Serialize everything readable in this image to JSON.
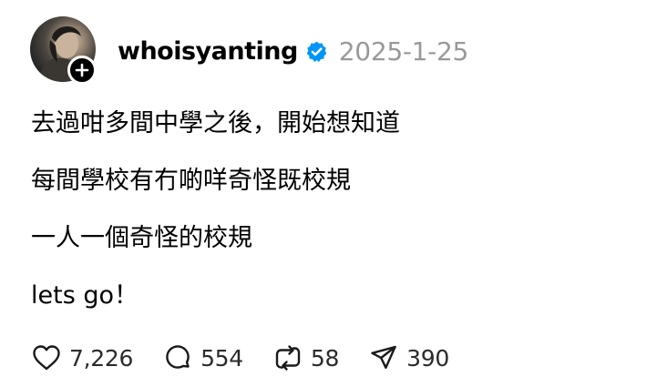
{
  "post": {
    "username": "whoisyanting",
    "timestamp": "2025-1-25",
    "verified": true,
    "lines": [
      "去過咁多間中學之後，開始想知道",
      "每間學校有冇啲咩奇怪既校規",
      "一人一個奇怪的校規",
      "lets go！"
    ]
  },
  "actions": {
    "likes": "7,226",
    "replies": "554",
    "reposts": "58",
    "shares": "390"
  },
  "icons": {
    "verified": "verified-badge-icon",
    "follow": "plus-icon",
    "like": "heart-icon",
    "reply": "comment-bubble-icon",
    "repost": "repost-arrows-icon",
    "share": "send-icon"
  },
  "colors": {
    "verified_blue": "#0095f6",
    "timestamp_gray": "#999999",
    "text": "#000000"
  }
}
